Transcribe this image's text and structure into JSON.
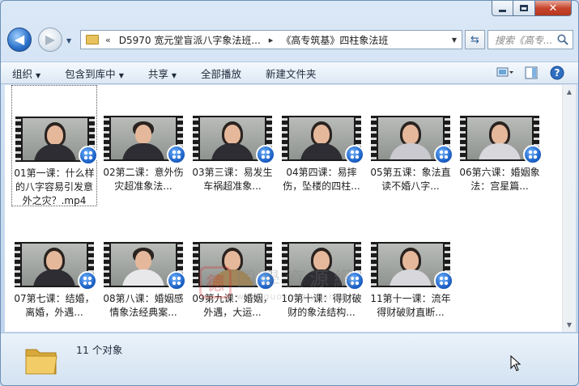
{
  "address": {
    "overflow": "«",
    "segments": [
      "D5970 宽元堂盲派八字象法班...",
      "《高专筑基》四柱象法班"
    ],
    "separator": "▸"
  },
  "search": {
    "placeholder": "搜索《高专..."
  },
  "toolbar": {
    "organize": "组织",
    "include_library": "包含到库中",
    "share": "共享",
    "play_all": "全部播放",
    "new_folder": "新建文件夹"
  },
  "files": [
    {
      "label": "01第一课：什么样的八字容易引发意外之灾？.mp4",
      "focused": true
    },
    {
      "label": "02第二课：意外伤灾超准象法..."
    },
    {
      "label": "03第三课：易发生车祸超准象..."
    },
    {
      "label": "04第四课：易摔伤，坠楼的四柱..."
    },
    {
      "label": "05第五课：象法直读不婚八字..."
    },
    {
      "label": "06第六课：婚姻象法：宫星篇..."
    },
    {
      "label": "07第七课：结婚，离婚，外遇..."
    },
    {
      "label": "08第八课：婚姻感情象法经典案..."
    },
    {
      "label": "09第九课：婚姻，外遇，大运..."
    },
    {
      "label": "10第十课：得财破财的象法结构..."
    },
    {
      "label": "11第十一课：流年得财破财直断..."
    }
  ],
  "watermark": {
    "seal": "德",
    "text": "国學資源網",
    "url": "www.guoxueziyuan.com"
  },
  "status": {
    "count": "11 个对象"
  },
  "colors": {
    "accent": "#1a5fc4",
    "titlebar": "#c7daee",
    "close": "#c7452d"
  }
}
